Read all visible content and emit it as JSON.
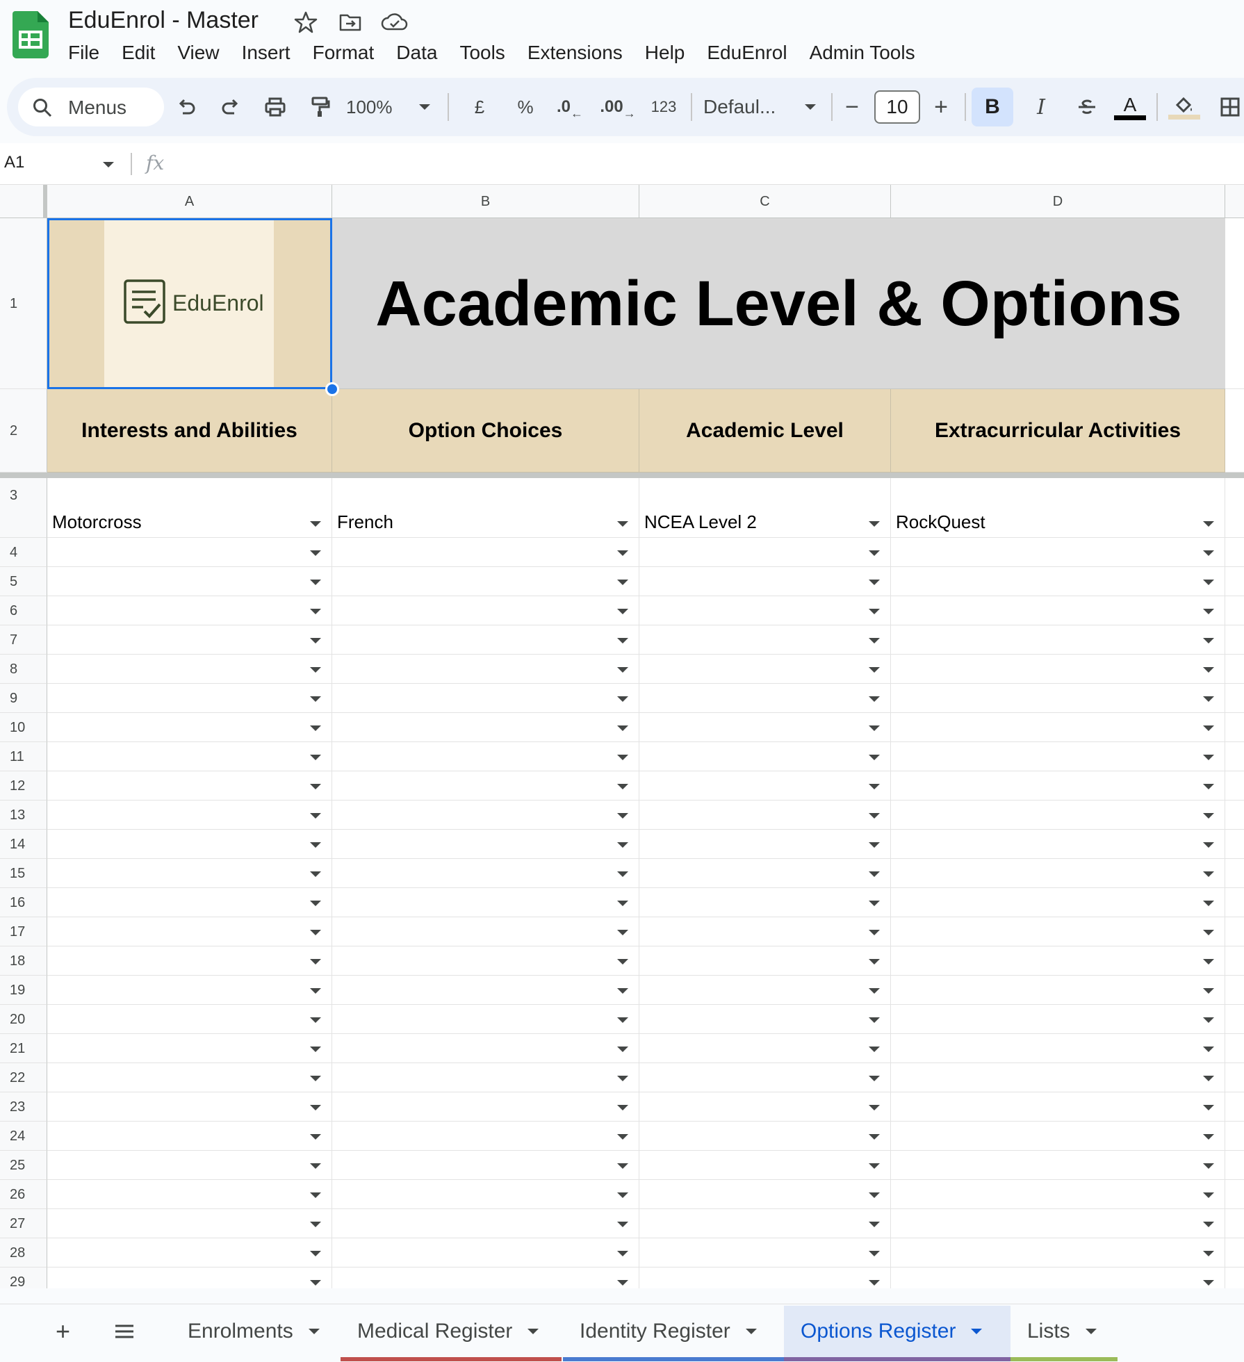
{
  "app": {
    "doc_title": "EduEnrol - Master",
    "menu": [
      "File",
      "Edit",
      "View",
      "Insert",
      "Format",
      "Data",
      "Tools",
      "Extensions",
      "Help",
      "EduEnrol",
      "Admin Tools"
    ]
  },
  "toolbar": {
    "search_label": "Menus",
    "zoom": "100%",
    "currency": "£",
    "percent": "%",
    "decrease_decimal": ".0",
    "increase_decimal": ".00",
    "number_format": "123",
    "font": "Defaul...",
    "font_size": "10",
    "bold": "B",
    "italic": "I",
    "text_color": "A"
  },
  "formula_bar": {
    "cell_ref": "A1",
    "fx": "fx",
    "value": ""
  },
  "grid": {
    "columns": [
      "A",
      "B",
      "C",
      "D"
    ],
    "logo_text": "EduEnrol",
    "title": "Academic Level & Options",
    "headers": [
      "Interests and Abilities",
      "Option Choices",
      "Academic Level",
      "Extracurricular Activities"
    ],
    "rows": [
      {
        "num": "1"
      },
      {
        "num": "2"
      },
      {
        "num": "3",
        "values": [
          "Motorcross",
          "French",
          "NCEA Level 2",
          "RockQuest"
        ]
      },
      {
        "num": "4"
      },
      {
        "num": "5"
      },
      {
        "num": "6"
      },
      {
        "num": "7"
      },
      {
        "num": "8"
      },
      {
        "num": "9"
      },
      {
        "num": "10"
      },
      {
        "num": "11"
      },
      {
        "num": "12"
      },
      {
        "num": "13"
      },
      {
        "num": "14"
      },
      {
        "num": "15"
      },
      {
        "num": "16"
      },
      {
        "num": "17"
      },
      {
        "num": "18"
      },
      {
        "num": "19"
      },
      {
        "num": "20"
      },
      {
        "num": "21"
      },
      {
        "num": "22"
      },
      {
        "num": "23"
      },
      {
        "num": "24"
      },
      {
        "num": "25"
      },
      {
        "num": "26"
      },
      {
        "num": "27"
      },
      {
        "num": "28"
      },
      {
        "num": "29"
      }
    ]
  },
  "sheet_tabs": [
    {
      "label": "Enrolments",
      "color": ""
    },
    {
      "label": "Medical Register",
      "color": "#c0504d"
    },
    {
      "label": "Identity Register",
      "color": "#4a7bd0"
    },
    {
      "label": "Options Register",
      "color": "#8064a2",
      "active": true
    },
    {
      "label": "Lists",
      "color": "#9bbb59"
    }
  ],
  "colors": {
    "header_fill": "#e8d9b9",
    "title_fill": "#d9d9d9",
    "selection": "#1a73e8",
    "active_tab_text": "#0b57d0"
  }
}
